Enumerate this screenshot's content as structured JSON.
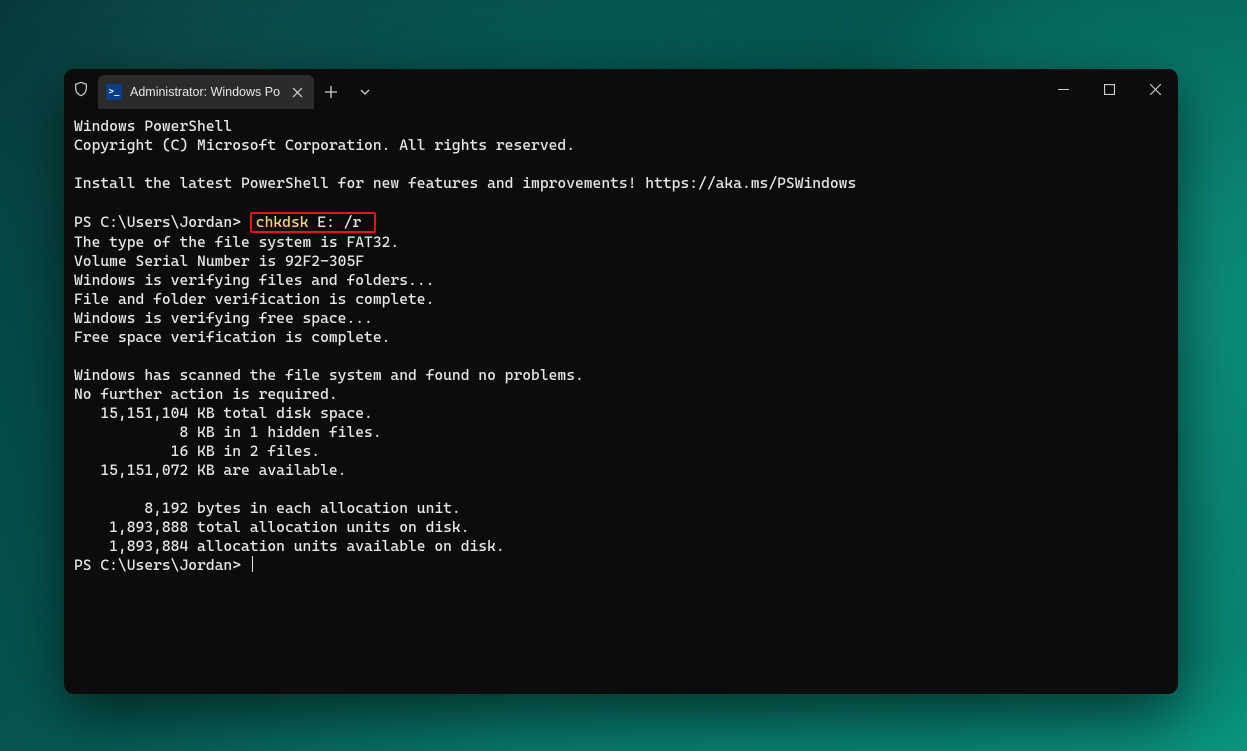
{
  "tab": {
    "title": "Administrator: Windows Powe"
  },
  "terminal": {
    "header1": "Windows PowerShell",
    "header2": "Copyright (C) Microsoft Corporation. All rights reserved.",
    "install_msg": "Install the latest PowerShell for new features and improvements! https://aka.ms/PSWindows",
    "prompt1_prefix": "PS C:\\Users\\Jordan> ",
    "highlight_cmd": "chkdsk",
    "highlight_args": " E: /r ",
    "out": [
      "The type of the file system is FAT32.",
      "Volume Serial Number is 92F2-305F",
      "Windows is verifying files and folders...",
      "File and folder verification is complete.",
      "Windows is verifying free space...",
      "Free space verification is complete.",
      "",
      "Windows has scanned the file system and found no problems.",
      "No further action is required.",
      "   15,151,104 KB total disk space.",
      "            8 KB in 1 hidden files.",
      "           16 KB in 2 files.",
      "   15,151,072 KB are available.",
      "",
      "        8,192 bytes in each allocation unit.",
      "    1,893,888 total allocation units on disk.",
      "    1,893,884 allocation units available on disk."
    ],
    "prompt2": "PS C:\\Users\\Jordan> "
  }
}
